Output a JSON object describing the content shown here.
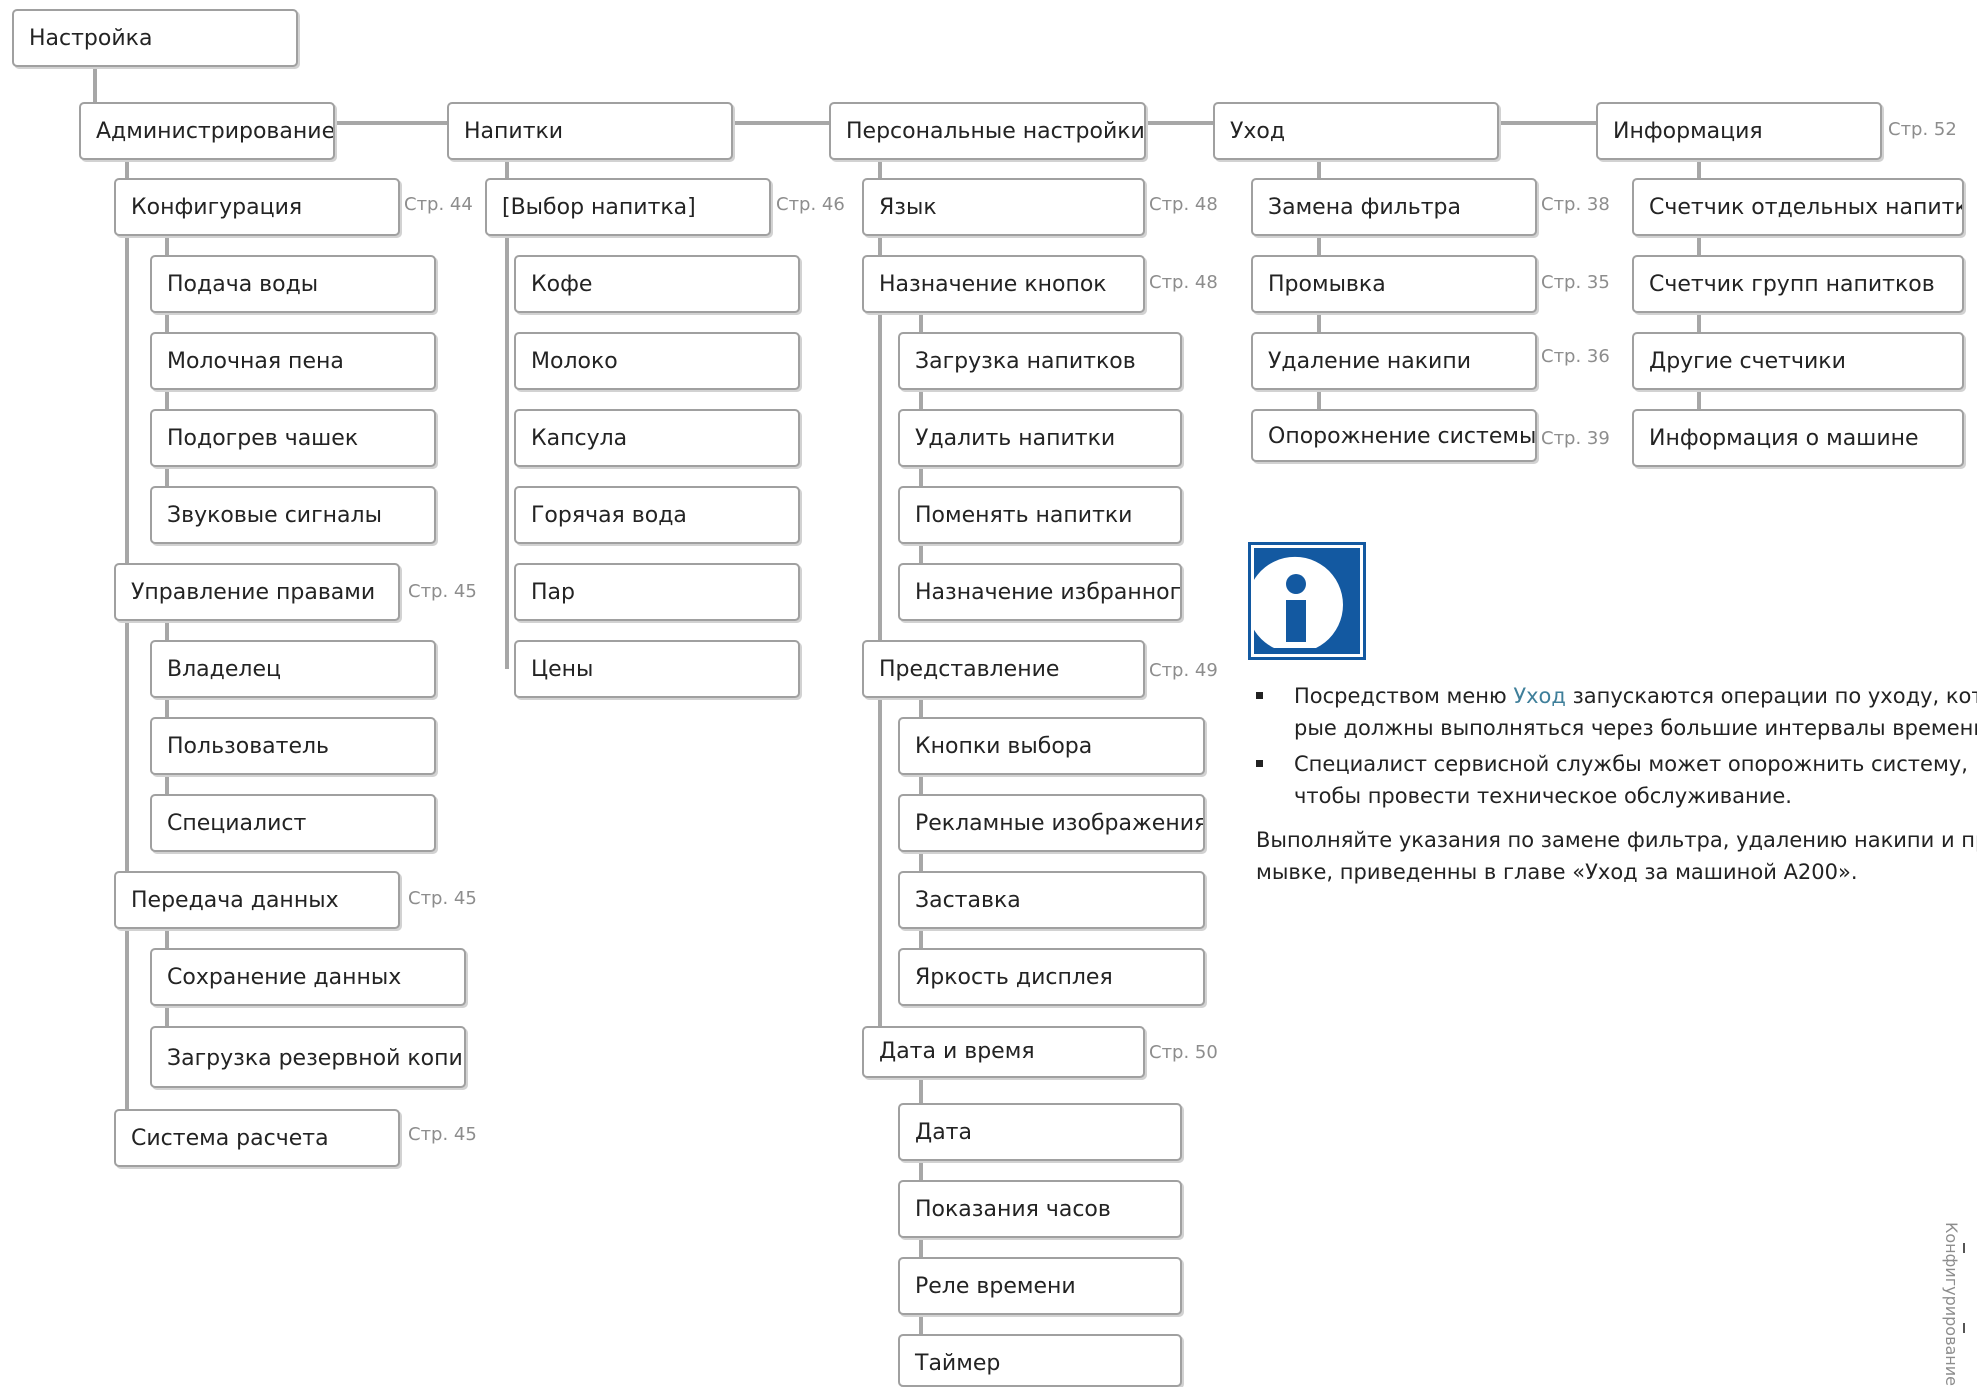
{
  "root": "Настройка",
  "columns": {
    "admin": {
      "title": "Администрирование",
      "groups": [
        {
          "label": "Конфигурация",
          "page": "Стр. 44",
          "items": [
            "Подача воды",
            "Молочная пена",
            "Подогрев чашек",
            "Звуковые сигналы"
          ]
        },
        {
          "label": "Управление правами",
          "page": "Стр. 45",
          "items": [
            "Владелец",
            "Пользователь",
            "Специалист"
          ]
        },
        {
          "label": "Передача данных",
          "page": "Стр. 45",
          "items": [
            "Сохранение данных",
            "Загрузка резервной копии"
          ]
        },
        {
          "label": "Система расчета",
          "page": "Стр. 45",
          "items": []
        }
      ]
    },
    "drinks": {
      "title": "Напитки",
      "groups": [
        {
          "label": "[Выбор напитка]",
          "page": "Стр. 46",
          "items": [
            "Кофе",
            "Молоко",
            "Капсула",
            "Горячая вода",
            "Пар",
            "Цены"
          ]
        }
      ]
    },
    "personal": {
      "title": "Персональные настройки",
      "groups": [
        {
          "label": "Язык",
          "page": "Стр. 48",
          "items": []
        },
        {
          "label": "Назначение кнопок",
          "page": "Стр. 48",
          "items": [
            "Загрузка напитков",
            "Удалить напитки",
            "Поменять напитки",
            "Назначение избранного"
          ]
        },
        {
          "label": "Представление",
          "page": "Стр. 49",
          "items": [
            "Кнопки выбора",
            "Рекламные изображения",
            "Заставка",
            "Яркость дисплея"
          ]
        },
        {
          "label": "Дата и время",
          "page": "Стр. 50",
          "items": [
            "Дата",
            "Показания часов",
            "Реле времени",
            "Таймер"
          ]
        }
      ]
    },
    "care": {
      "title": "Уход",
      "items": [
        {
          "label": "Замена фильтра",
          "page": "Стр. 38"
        },
        {
          "label": "Промывка",
          "page": "Стр. 35"
        },
        {
          "label": "Удаление накипи",
          "page": "Стр. 36"
        },
        {
          "label": "Опорожнение системы",
          "page": "Стр. 39"
        }
      ]
    },
    "info": {
      "title": "Информация",
      "page": "Стр. 52",
      "items": [
        "Счетчик отдельных напитков",
        "Счетчик групп напитков",
        "Другие счетчики",
        "Информация о машине"
      ]
    }
  },
  "notes": {
    "bullet1_pre": "Посредством меню ",
    "bullet1_link": "Уход",
    "bullet1_line1_post": " запускаются операции по уходу, кото-",
    "bullet1_line2": "рые должны выполняться через большие интервалы времени.",
    "bullet2_line1": "Специалист сервисной службы может опорожнить систему,",
    "bullet2_line2": "чтобы провести техническое обслуживание.",
    "para_line1": "Выполняйте указания по замене фильтра, удалению накипи и про-",
    "para_line2": "мывке, приведенны в главе «Уход за машиной A200»."
  },
  "side_label": "Конфигурирование",
  "colors": {
    "info_blue": "#1359a1",
    "link": "#3f7f9a",
    "line": "#a7a7a7"
  }
}
